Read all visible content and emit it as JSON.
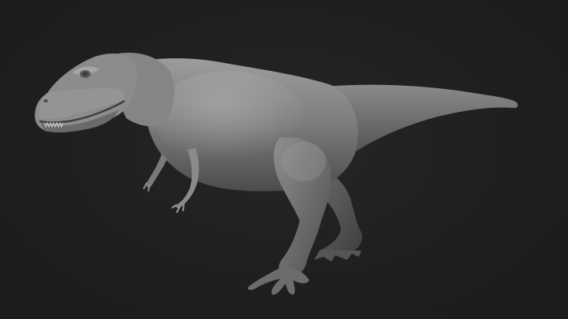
{
  "scene": {
    "subject_icon": "dinosaur-sculpt",
    "colors": {
      "background": "#1e1e1e",
      "clay_light": "#a9a9a9",
      "clay_mid": "#7d7d7d",
      "clay_dark": "#4a4a4a"
    }
  }
}
